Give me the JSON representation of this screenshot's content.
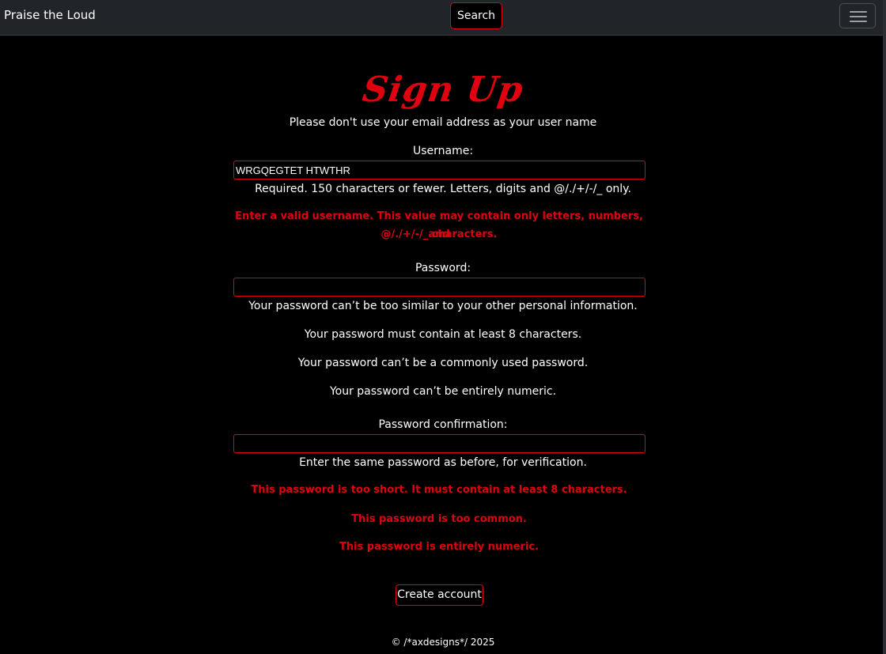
{
  "navbar": {
    "brand": "Praise the Loud",
    "search_label": "Search",
    "menu_icon": "hamburger-menu-icon"
  },
  "form": {
    "title": "Sign Up",
    "intro": "Please don't use your email address as your user name",
    "username": {
      "label": "Username:",
      "value": "WRGQEGTET HTWTHR",
      "help": "Required. 150 characters or fewer. Letters, digits and @/./+/-/_ only.",
      "error_line1": "Enter a valid username. This value may contain only letters, numbers, and",
      "error_line2": "@/./+/-/_ characters."
    },
    "password": {
      "label": "Password:",
      "value": "",
      "help": [
        "Your password can’t be too similar to your other personal information.",
        "Your password must contain at least 8 characters.",
        "Your password can’t be a commonly used password.",
        "Your password can’t be entirely numeric."
      ]
    },
    "password_confirmation": {
      "label": "Password confirmation:",
      "value": "",
      "help": "Enter the same password as before, for verification.",
      "errors": [
        "This password is too short. It must contain at least 8 characters.",
        "This password is too common.",
        "This password is entirely numeric."
      ]
    },
    "submit_label": "Create account"
  },
  "footer": {
    "text": "© /*axdesigns*/ 2025"
  },
  "colors": {
    "accent": "#e00010",
    "navbar_bg": "#212529",
    "page_bg": "#000000",
    "text": "#ffffff"
  }
}
